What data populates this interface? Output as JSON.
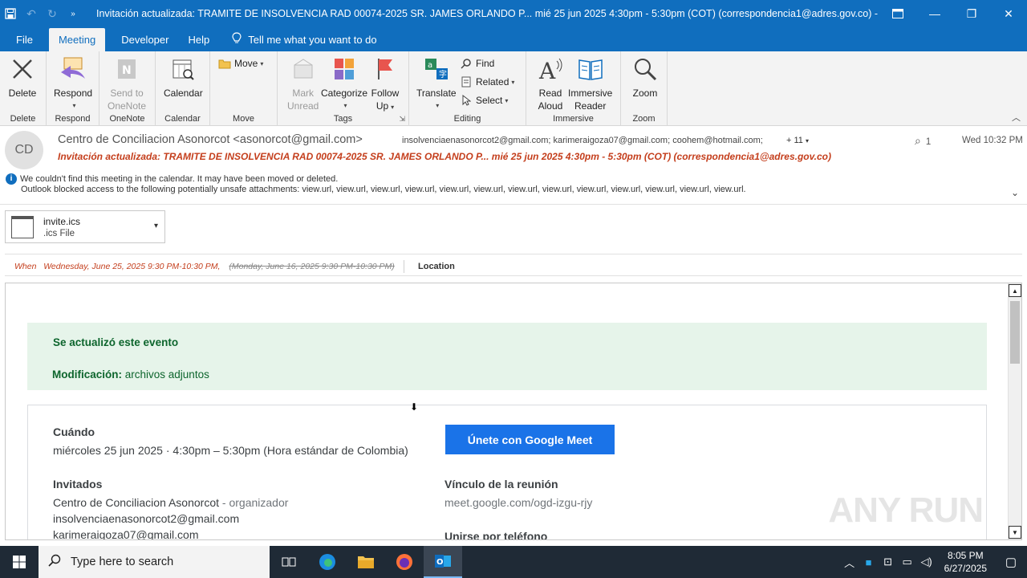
{
  "window": {
    "title": "Invitación actualizada: TRAMITE DE INSOLVENCIA RAD 00074-2025 SR. JAMES ORLANDO P... mié 25 jun 2025 4:30pm - 5:30pm (COT) (correspondencia1@adres.gov.co)  -  Meeting"
  },
  "menu": {
    "tabs": [
      "File",
      "Meeting",
      "Developer",
      "Help"
    ],
    "tell_me": "Tell me what you want to do"
  },
  "ribbon": {
    "delete": {
      "btn": "Delete",
      "group": "Delete"
    },
    "respond": {
      "btn": "Respond",
      "group": "Respond"
    },
    "onenote": {
      "btn1": "Send to",
      "btn2": "OneNote",
      "group": "OneNote"
    },
    "calendar": {
      "btn": "Calendar",
      "group": "Calendar"
    },
    "move": {
      "btn": "Move",
      "group": "Move"
    },
    "tags": {
      "mark1": "Mark",
      "mark2": "Unread",
      "categorize": "Categorize",
      "follow1": "Follow",
      "follow2": "Up",
      "group": "Tags"
    },
    "editing": {
      "translate": "Translate",
      "find": "Find",
      "related": "Related",
      "select": "Select",
      "group": "Editing"
    },
    "immersive": {
      "read1": "Read",
      "read2": "Aloud",
      "imm1": "Immersive",
      "imm2": "Reader",
      "group": "Immersive"
    },
    "zoom": {
      "btn": "Zoom",
      "group": "Zoom"
    }
  },
  "header": {
    "avatar": "CD",
    "sender": "Centro de Conciliacion Asonorcot <asonorcot@gmail.com>",
    "recipients": "insolvenciaenasonorcot2@gmail.com; karimeraigoza07@gmail.com; coohem@hotmail.com;",
    "more": "+ 11",
    "attachment_count": "1",
    "date": "Wed 10:32 PM",
    "subject": "Invitación actualizada: TRAMITE DE INSOLVENCIA RAD 00074-2025 SR. JAMES ORLANDO P... mié 25 jun 2025 4:30pm - 5:30pm (COT) (correspondencia1@adres.gov.co)",
    "info1": "We couldn't find this meeting in the calendar. It may have been moved or deleted.",
    "info2": "Outlook blocked access to the following potentially unsafe attachments: view.url, view.url, view.url, view.url, view.url, view.url, view.url, view.url, view.url, view.url, view.url, view.url, view.url."
  },
  "attachment": {
    "name": "invite.ics",
    "type": ".ics File"
  },
  "meeting": {
    "when_label": "When",
    "when_value": "Wednesday, June 25, 2025 9:30 PM-10:30 PM,",
    "old_when": "(Monday, June 16, 2025 9:30 PM-10:30 PM)",
    "location_label": "Location"
  },
  "body": {
    "notice_title": "Se actualizó este evento",
    "mod_label": "Modificación:",
    "mod_value": "archivos adjuntos",
    "when_label": "Cuándo",
    "when_value": "miércoles 25 jun 2025 · 4:30pm – 5:30pm (Hora estándar de Colombia)",
    "guests_label": "Invitados",
    "organizer_name": "Centro de Conciliacion Asonorcot",
    "organizer_tag": " - organizador",
    "guest1": "insolvenciaenasonorcot2@gmail.com",
    "guest2": "karimeraigoza07@gmail.com",
    "meet_button": "Únete con Google Meet",
    "link_label": "Vínculo de la reunión",
    "link_value": "meet.google.com/ogd-izgu-rjy",
    "phone_label": "Unirse por teléfono",
    "watermark": "ANY RUN"
  },
  "taskbar": {
    "search_placeholder": "Type here to search",
    "time": "8:05 PM",
    "date": "6/27/2025"
  },
  "colors": {
    "accent": "#106ebe",
    "subject_red": "#c43e1c",
    "notice_green": "#0d652d",
    "meet_blue": "#1a73e8"
  }
}
